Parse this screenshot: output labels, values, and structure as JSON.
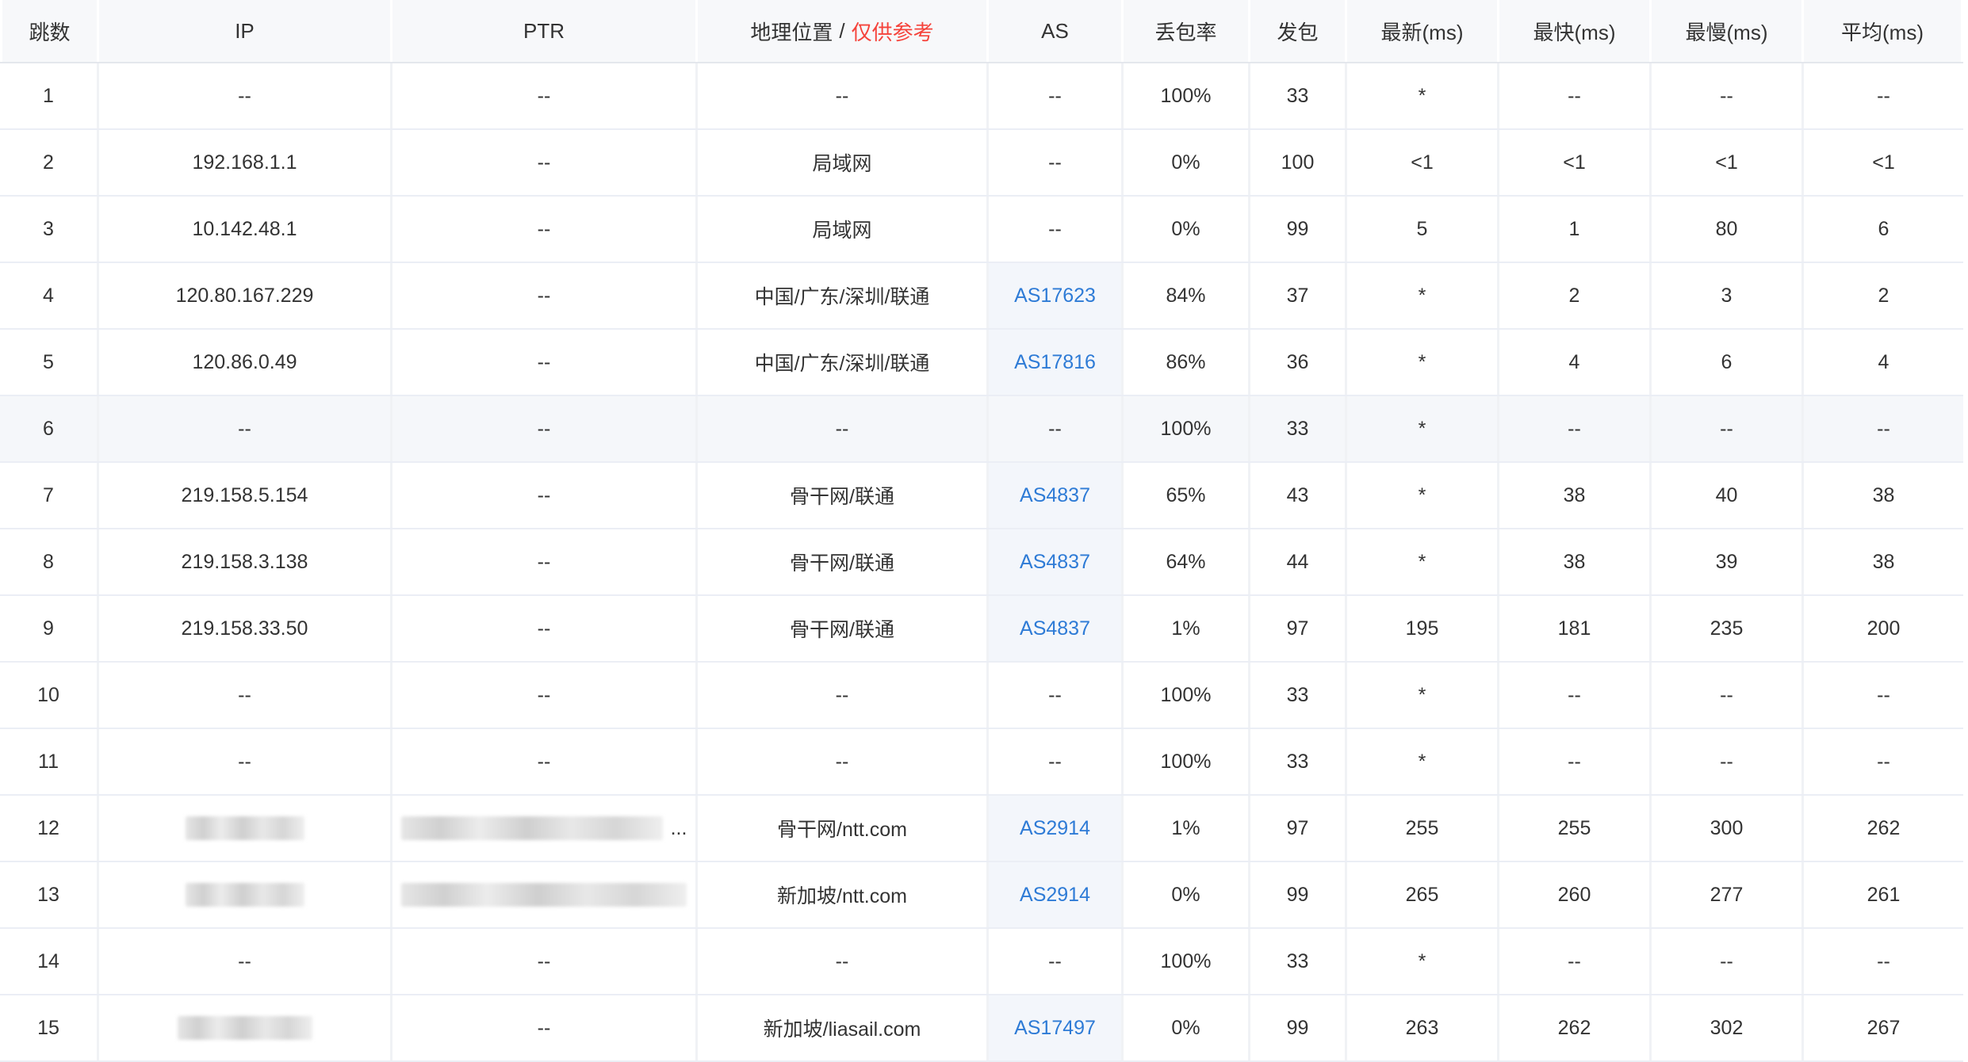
{
  "headers": {
    "hop": "跳数",
    "ip": "IP",
    "ptr": "PTR",
    "geo": "地理位置",
    "geo_sep": "/",
    "geo_note": "仅供参考",
    "as": "AS",
    "loss": "丢包率",
    "sent": "发包",
    "last": "最新(ms)",
    "best": "最快(ms)",
    "worst": "最慢(ms)",
    "avg": "平均(ms)"
  },
  "ellipsis": "...",
  "colors": {
    "link": "#2e7bd6",
    "note": "#f5433b",
    "header_bg": "#f7f8fa",
    "hover_bg": "#f5f7fa"
  },
  "rows": [
    {
      "hop": "1",
      "ip": "--",
      "ptr": "--",
      "geo": "--",
      "as": "--",
      "loss": "100%",
      "sent": "33",
      "last": "*",
      "best": "--",
      "worst": "--",
      "avg": "--"
    },
    {
      "hop": "2",
      "ip": "192.168.1.1",
      "ptr": "--",
      "geo": "局域网",
      "as": "--",
      "loss": "0%",
      "sent": "100",
      "last": "<1",
      "best": "<1",
      "worst": "<1",
      "avg": "<1"
    },
    {
      "hop": "3",
      "ip": "10.142.48.1",
      "ptr": "--",
      "geo": "局域网",
      "as": "--",
      "loss": "0%",
      "sent": "99",
      "last": "5",
      "best": "1",
      "worst": "80",
      "avg": "6"
    },
    {
      "hop": "4",
      "ip": "120.80.167.229",
      "ptr": "--",
      "geo": "中国/广东/深圳/联通",
      "as": "AS17623",
      "loss": "84%",
      "sent": "37",
      "last": "*",
      "best": "2",
      "worst": "3",
      "avg": "2"
    },
    {
      "hop": "5",
      "ip": "120.86.0.49",
      "ptr": "--",
      "geo": "中国/广东/深圳/联通",
      "as": "AS17816",
      "loss": "86%",
      "sent": "36",
      "last": "*",
      "best": "4",
      "worst": "6",
      "avg": "4"
    },
    {
      "hop": "6",
      "ip": "--",
      "ptr": "--",
      "geo": "--",
      "as": "--",
      "loss": "100%",
      "sent": "33",
      "last": "*",
      "best": "--",
      "worst": "--",
      "avg": "--"
    },
    {
      "hop": "7",
      "ip": "219.158.5.154",
      "ptr": "--",
      "geo": "骨干网/联通",
      "as": "AS4837",
      "loss": "65%",
      "sent": "43",
      "last": "*",
      "best": "38",
      "worst": "40",
      "avg": "38"
    },
    {
      "hop": "8",
      "ip": "219.158.3.138",
      "ptr": "--",
      "geo": "骨干网/联通",
      "as": "AS4837",
      "loss": "64%",
      "sent": "44",
      "last": "*",
      "best": "38",
      "worst": "39",
      "avg": "38"
    },
    {
      "hop": "9",
      "ip": "219.158.33.50",
      "ptr": "--",
      "geo": "骨干网/联通",
      "as": "AS4837",
      "loss": "1%",
      "sent": "97",
      "last": "195",
      "best": "181",
      "worst": "235",
      "avg": "200"
    },
    {
      "hop": "10",
      "ip": "--",
      "ptr": "--",
      "geo": "--",
      "as": "--",
      "loss": "100%",
      "sent": "33",
      "last": "*",
      "best": "--",
      "worst": "--",
      "avg": "--"
    },
    {
      "hop": "11",
      "ip": "--",
      "ptr": "--",
      "geo": "--",
      "as": "--",
      "loss": "100%",
      "sent": "33",
      "last": "*",
      "best": "--",
      "worst": "--",
      "avg": "--"
    },
    {
      "hop": "12",
      "ip": "",
      "ptr": "",
      "geo": "骨干网/ntt.com",
      "as": "AS2914",
      "loss": "1%",
      "sent": "97",
      "last": "255",
      "best": "255",
      "worst": "300",
      "avg": "262"
    },
    {
      "hop": "13",
      "ip": "",
      "ptr": "",
      "geo": "新加坡/ntt.com",
      "as": "AS2914",
      "loss": "0%",
      "sent": "99",
      "last": "265",
      "best": "260",
      "worst": "277",
      "avg": "261"
    },
    {
      "hop": "14",
      "ip": "--",
      "ptr": "--",
      "geo": "--",
      "as": "--",
      "loss": "100%",
      "sent": "33",
      "last": "*",
      "best": "--",
      "worst": "--",
      "avg": "--"
    },
    {
      "hop": "15",
      "ip": "",
      "ptr": "--",
      "geo": "新加坡/liasail.com",
      "as": "AS17497",
      "loss": "0%",
      "sent": "99",
      "last": "263",
      "best": "262",
      "worst": "302",
      "avg": "267"
    }
  ]
}
